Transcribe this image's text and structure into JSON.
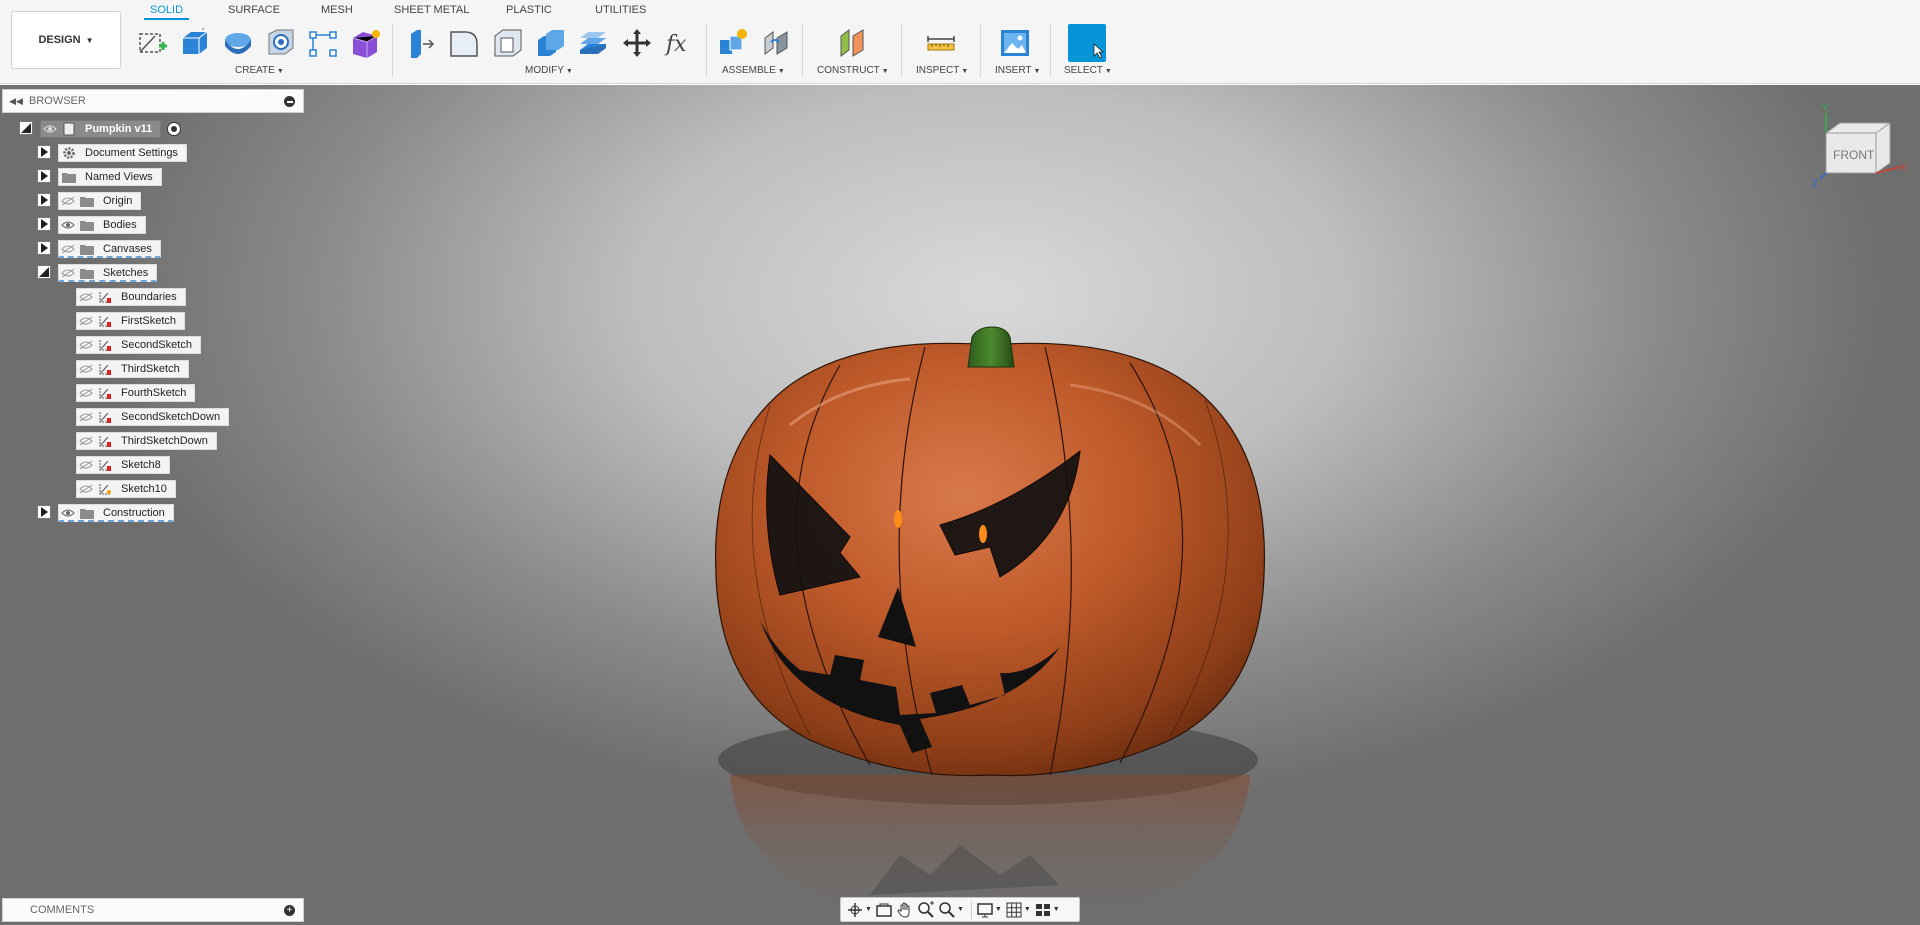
{
  "toolbar": {
    "workspace": "DESIGN",
    "tabs": [
      "SOLID",
      "SURFACE",
      "MESH",
      "SHEET METAL",
      "PLASTIC",
      "UTILITIES"
    ],
    "groups": {
      "create": "CREATE",
      "modify": "MODIFY",
      "assemble": "ASSEMBLE",
      "construct": "CONSTRUCT",
      "inspect": "INSPECT",
      "insert": "INSERT",
      "select": "SELECT"
    },
    "accent": "#0696d7"
  },
  "browser": {
    "title": "BROWSER",
    "root": "Pumpkin v11",
    "items": [
      "Document Settings",
      "Named Views",
      "Origin",
      "Bodies",
      "Canvases",
      "Sketches",
      "Construction"
    ],
    "sketches": [
      "Boundaries",
      "FirstSketch",
      "SecondSketch",
      "ThirdSketch",
      "FourthSketch",
      "SecondSketchDown",
      "ThirdSketchDown",
      "Sketch8",
      "Sketch10"
    ]
  },
  "viewcube": {
    "face": "FRONT",
    "x_axis": "X",
    "y_axis": "Y",
    "z_axis": "Z"
  },
  "comments": {
    "title": "COMMENTS"
  }
}
